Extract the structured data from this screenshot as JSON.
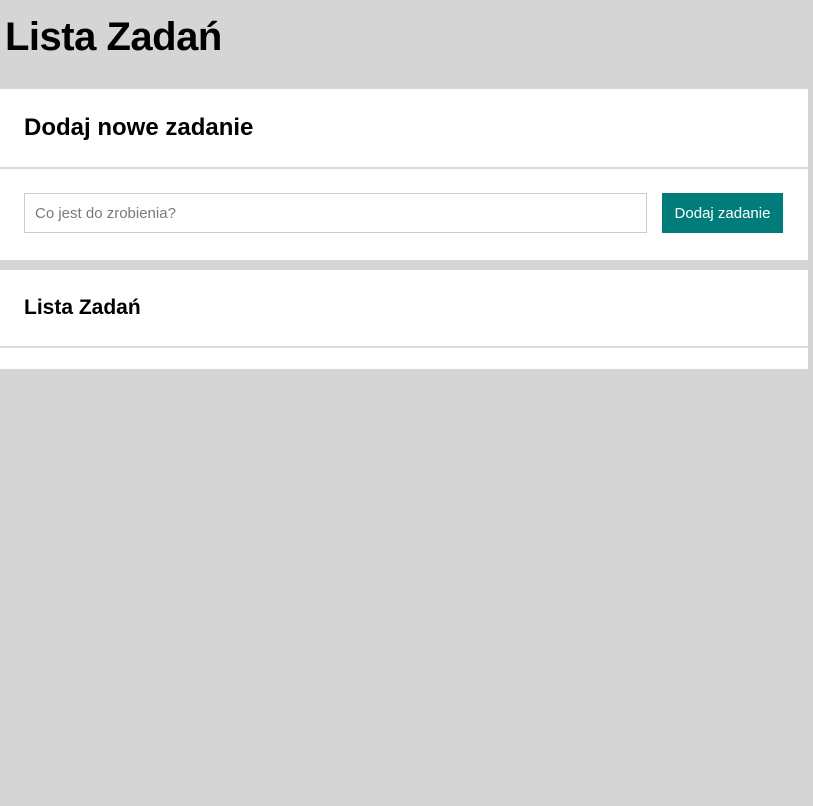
{
  "page": {
    "title": "Lista Zadań"
  },
  "add_card": {
    "heading": "Dodaj nowe zadanie",
    "input": {
      "placeholder": "Co jest do zrobienia?",
      "value": ""
    },
    "button_label": "Dodaj zadanie"
  },
  "list_card": {
    "heading": "Lista Zadań",
    "items": []
  },
  "colors": {
    "background": "#d5d5d5",
    "card": "#ffffff",
    "accent": "#007c7a",
    "divider": "#d9d9d9"
  }
}
